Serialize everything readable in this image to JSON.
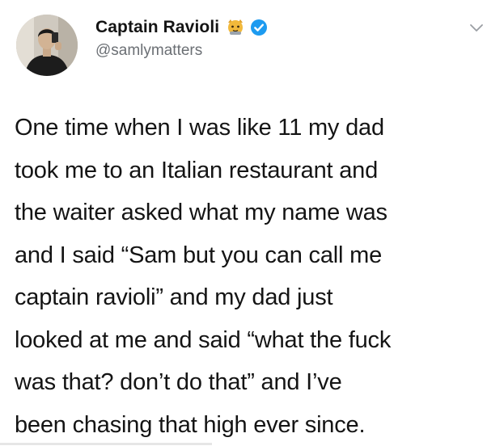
{
  "author": {
    "display_name": "Captain Ravioli",
    "handle": "@samlymatters",
    "emoji_icon": "cat-emoji-icon",
    "verified_icon": "verified-badge-icon",
    "verified_color": "#1d9bf0"
  },
  "menu": {
    "icon": "chevron-down-icon"
  },
  "tweet": {
    "lines": [
      "One time when I was like 11 my dad",
      "took me to an Italian restaurant and",
      "the waiter asked what my name was",
      "and I said “Sam but you can call me",
      "captain ravioli” and my dad just",
      "looked at me and said “what the fuck",
      "was that? don’t do that” and I’ve",
      "been chasing that high ever since."
    ]
  },
  "colors": {
    "text": "#141414",
    "handle": "#6b6f74",
    "background": "#ffffff"
  }
}
